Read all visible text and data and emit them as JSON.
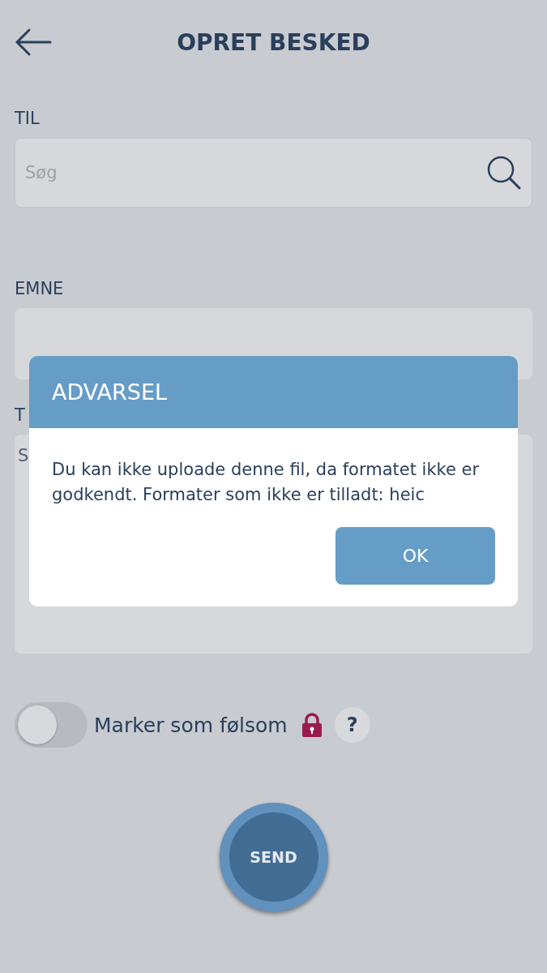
{
  "header": {
    "title": "OPRET BESKED"
  },
  "fields": [
    {
      "kind": "search",
      "label": "TIL",
      "placeholder": "Søg"
    },
    {
      "kind": "input",
      "label": "EMNE"
    },
    {
      "kind": "textarea",
      "label": "T",
      "placeholder": "S"
    }
  ],
  "sensitive_toggle": {
    "label": "Marker som følsom",
    "on": false,
    "help": "?"
  },
  "send_button": "SEND",
  "dialog": {
    "title": "ADVARSEL",
    "message": "Du kan ikke uploade denne fil, da formatet ikke er godkendt. Formater som ikke er tilladt: heic",
    "buttons": [
      "OK"
    ]
  }
}
